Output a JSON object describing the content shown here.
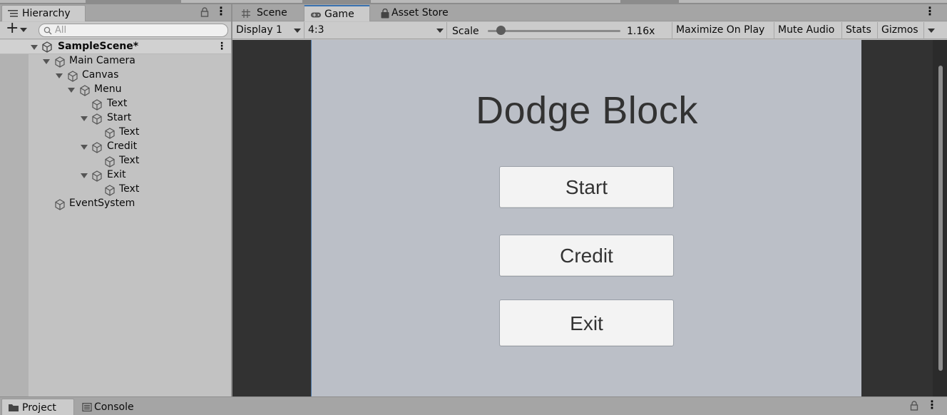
{
  "hierarchy": {
    "tab_label": "Hierarchy",
    "search_placeholder": "All",
    "scene": "SampleScene*",
    "items": [
      {
        "label": "Main Camera"
      },
      {
        "label": "Canvas"
      },
      {
        "label": "Menu"
      },
      {
        "label": "Text"
      },
      {
        "label": "Start"
      },
      {
        "label": "Text"
      },
      {
        "label": "Credit"
      },
      {
        "label": "Text"
      },
      {
        "label": "Exit"
      },
      {
        "label": "Text"
      },
      {
        "label": "EventSystem"
      }
    ]
  },
  "tabs": {
    "scene": "Scene",
    "game": "Game",
    "asset_store": "Asset Store"
  },
  "game_toolbar": {
    "display": "Display 1",
    "aspect": "4:3",
    "scale_label": "Scale",
    "scale_value": "1.16x",
    "maximize": "Maximize On Play",
    "mute": "Mute Audio",
    "stats": "Stats",
    "gizmos": "Gizmos"
  },
  "game_view": {
    "title": "Dodge Block",
    "buttons": {
      "start": "Start",
      "credit": "Credit",
      "exit": "Exit"
    }
  },
  "bottom_tabs": {
    "project": "Project",
    "console": "Console"
  },
  "colors": {
    "accent": "#3a72b0",
    "game_background": "#bbbfc7",
    "viewport_background": "#323232"
  }
}
